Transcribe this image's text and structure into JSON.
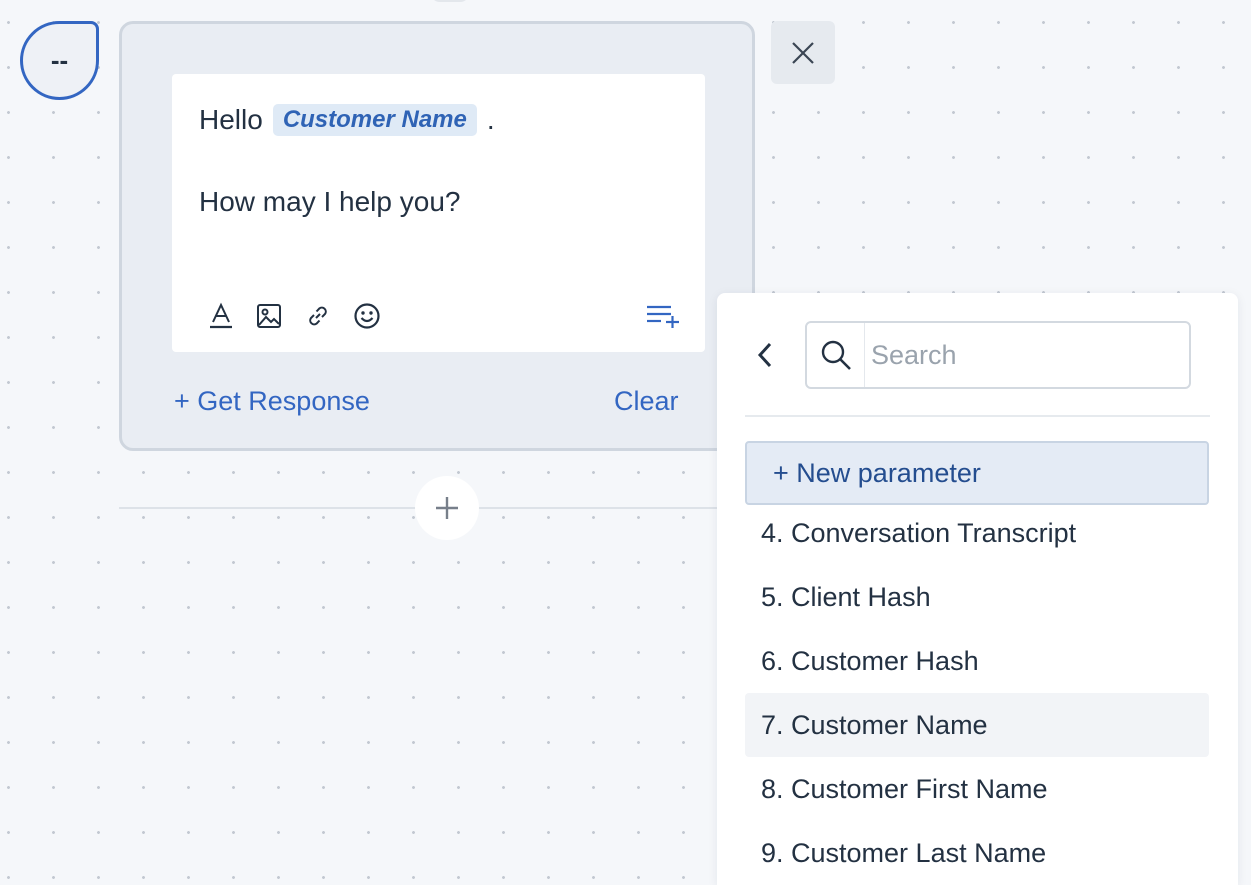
{
  "node": {
    "badge": "--",
    "message": {
      "greeting": "Hello",
      "param_chip": "Customer Name",
      "punct": ".",
      "line2": "How may I help you?"
    },
    "toolbar": {
      "text_format": "text-format-icon",
      "image": "image-icon",
      "link": "link-icon",
      "emoji": "emoji-icon",
      "insert_parameter": "insert-parameter-icon"
    },
    "get_response_label": "+ Get Response",
    "clear_label": "Clear"
  },
  "panel": {
    "search_placeholder": "Search",
    "new_parameter_label": "+ New parameter",
    "items": [
      "4. Conversation Transcript",
      "5. Client Hash",
      "6. Customer Hash",
      "7. Customer Name",
      "8. Customer First Name",
      "9. Customer Last Name"
    ],
    "hovered_index": 3
  },
  "colors": {
    "accent": "#3366c2",
    "chip_bg": "#dfeaf6",
    "canvas_bg": "#f5f7fa"
  }
}
